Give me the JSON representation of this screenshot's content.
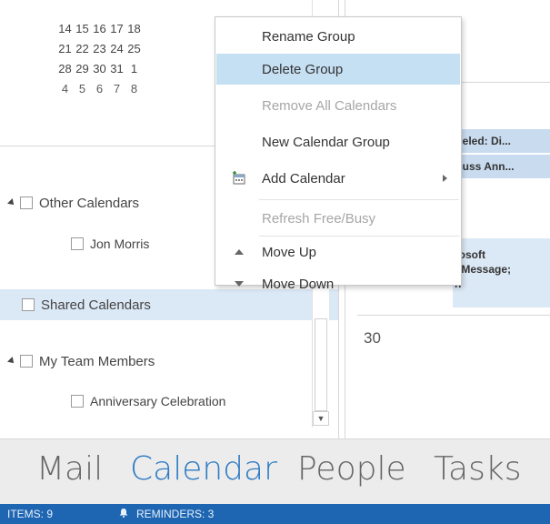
{
  "mini_calendar": {
    "rows": [
      [
        "14",
        "15",
        "16",
        "17",
        "18"
      ],
      [
        "21",
        "22",
        "23",
        "24",
        "25"
      ],
      [
        "28",
        "29",
        "30",
        "31",
        "1"
      ],
      [
        "4",
        "5",
        "6",
        "7",
        "8"
      ]
    ]
  },
  "folder_tree": {
    "other_calendars": "Other Calendars",
    "jon_morris": "Jon Morris",
    "shared_calendars": "Shared Calendars",
    "my_team_members": "My Team Members",
    "anniversary_celebration": "Anniversary Celebration"
  },
  "calendar_view": {
    "appointment_1": "celed: Di...",
    "appointment_2": "cuss Ann...",
    "appointment_3_line1": "rosoft",
    "appointment_3_line2": ": Message;",
    "appointment_3_line3": "n",
    "day_number": "30"
  },
  "context_menu": {
    "items": [
      {
        "label": "Rename Group",
        "state": "normal"
      },
      {
        "label": "Delete Group",
        "state": "hover"
      },
      {
        "label": "Remove All Calendars",
        "state": "disabled"
      },
      {
        "label": "New Calendar Group",
        "state": "normal"
      },
      {
        "label": "Add Calendar",
        "state": "normal",
        "icon": "add-calendar-icon",
        "submenu": true
      },
      {
        "label": "Refresh Free/Busy",
        "state": "disabled"
      },
      {
        "label": "Move Up",
        "state": "normal",
        "icon": "arrow-up-icon"
      },
      {
        "label": "Move Down",
        "state": "normal",
        "icon": "arrow-down-icon"
      }
    ]
  },
  "navigation": {
    "items": [
      "Mail",
      "Calendar",
      "People",
      "Tasks"
    ],
    "active": "Calendar"
  },
  "status_bar": {
    "items_count": "ITEMS: 9",
    "reminders": "REMINDERS: 3"
  },
  "colors": {
    "accent": "#2e7bc4",
    "status_bar": "#1f66b2",
    "menu_hover": "#c5dff3",
    "selection": "#dbe8f5",
    "appointment": "#c9dcef"
  }
}
